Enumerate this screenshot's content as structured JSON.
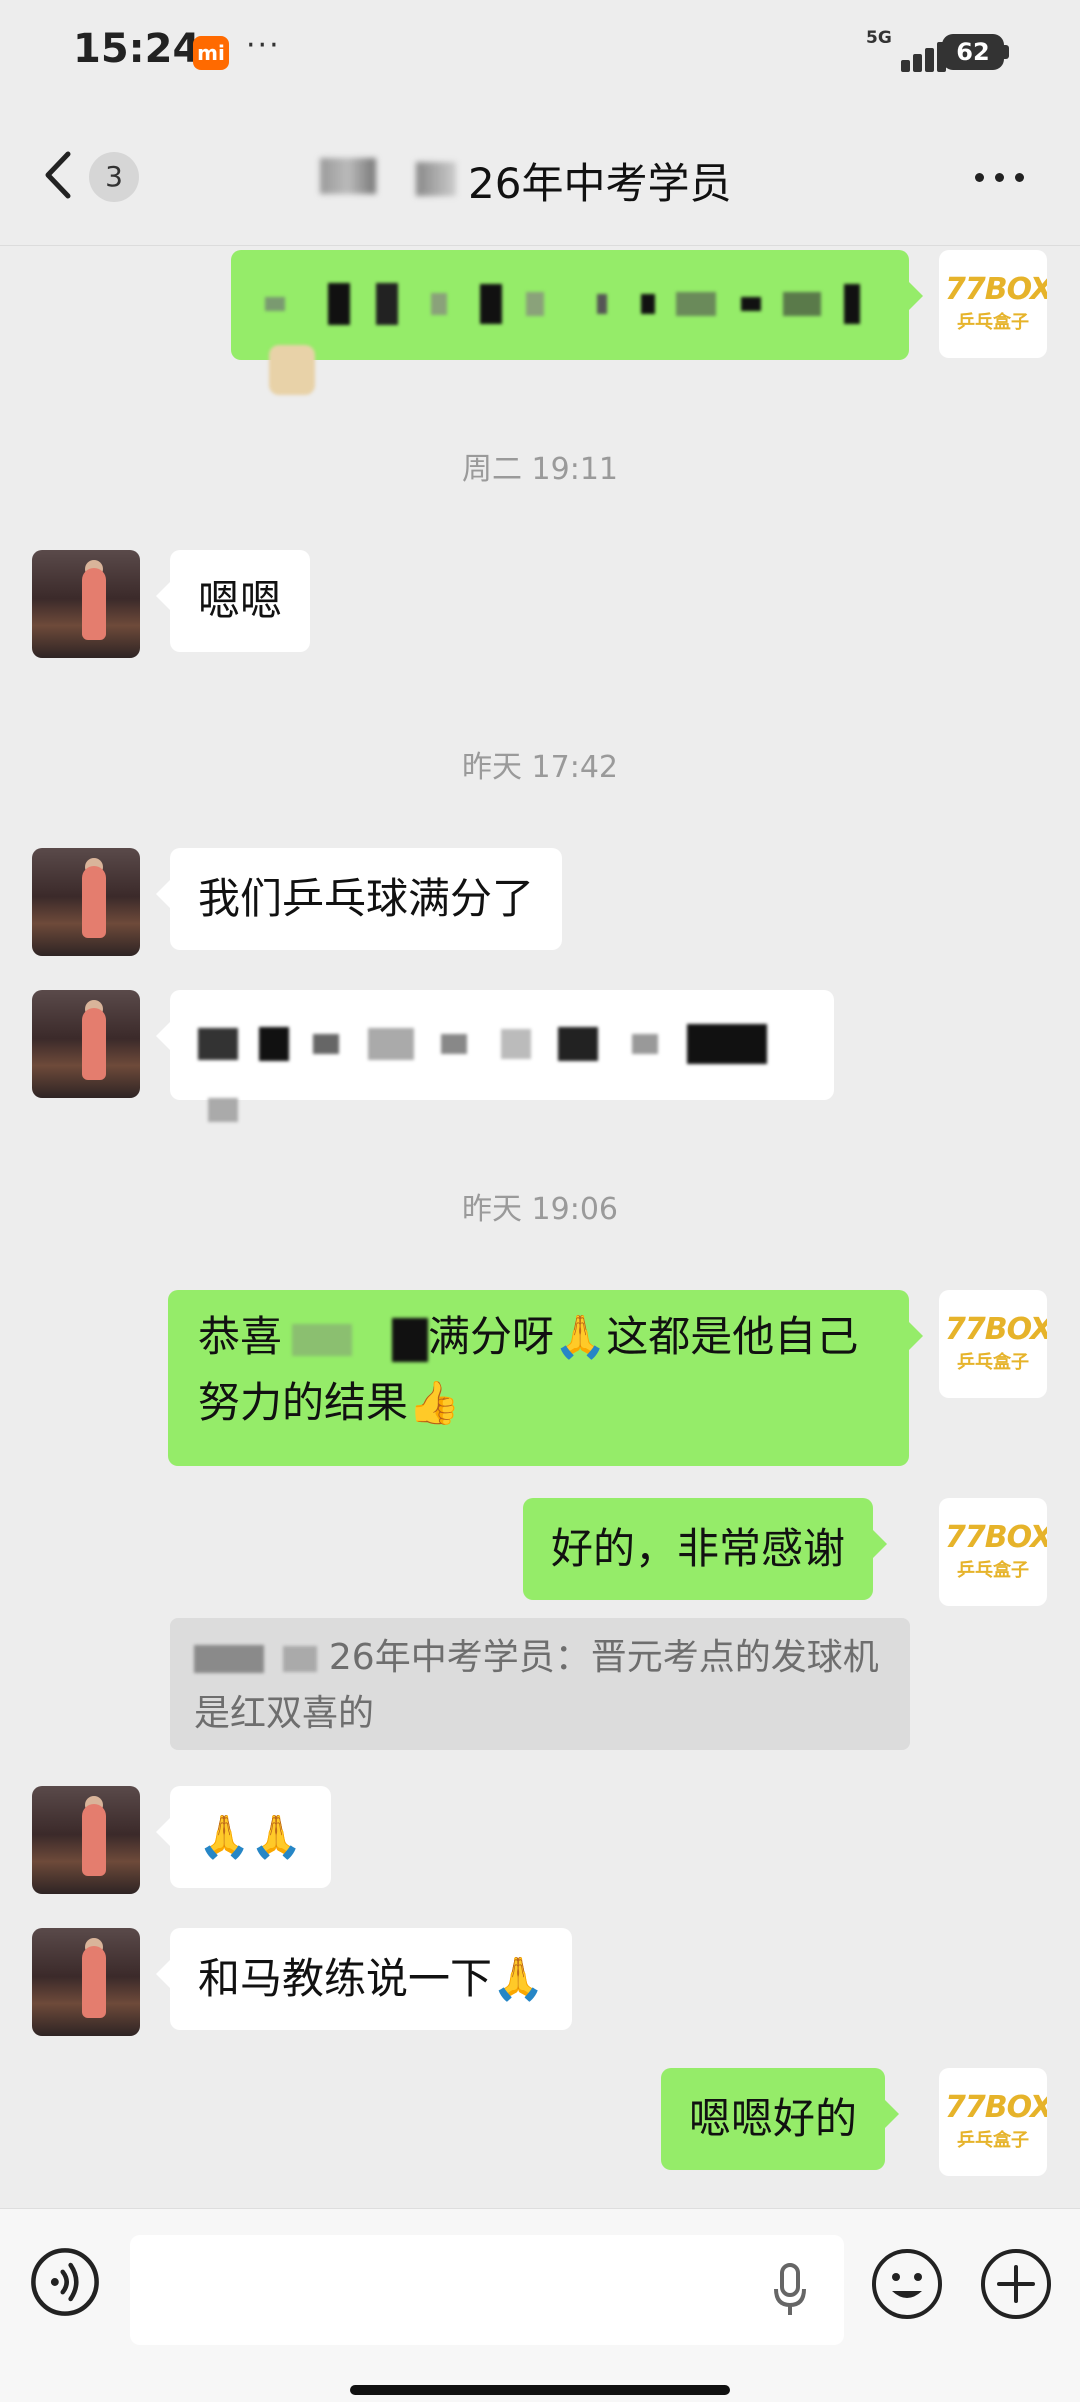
{
  "status_bar": {
    "time": "15:24",
    "carrier_badge": "mi",
    "overflow": "···",
    "network": "5G",
    "battery": "62"
  },
  "header": {
    "unread_count": "3",
    "title": "26年中考学员"
  },
  "messages": [
    {
      "side": "out",
      "text": ""
    },
    {
      "type": "time",
      "text": "周二 19:11"
    },
    {
      "side": "in",
      "text": "嗯嗯"
    },
    {
      "type": "time",
      "text": "昨天 17:42"
    },
    {
      "side": "in",
      "text": "我们乒乓球满分了"
    },
    {
      "side": "in",
      "text": ""
    },
    {
      "type": "time",
      "text": "昨天 19:06"
    },
    {
      "side": "out",
      "text_a": "恭喜",
      "text_b": "满分呀🙏这都是他自己努力的结果👍"
    },
    {
      "side": "out",
      "text": "好的，非常感谢"
    },
    {
      "type": "quote",
      "text_a": "26年中考学员：晋元考点的发球机是红双喜的"
    },
    {
      "side": "in",
      "text": "🙏🙏"
    },
    {
      "side": "in",
      "text": "和马教练说一下🙏"
    },
    {
      "side": "out",
      "text": "嗯嗯好的"
    }
  ],
  "avatars": {
    "self_logo_top": "77BOX",
    "self_logo_bottom": "乒乓盒子"
  },
  "colors": {
    "background": "#ededed",
    "outgoing_bubble": "#95ec69",
    "incoming_bubble": "#ffffff"
  }
}
